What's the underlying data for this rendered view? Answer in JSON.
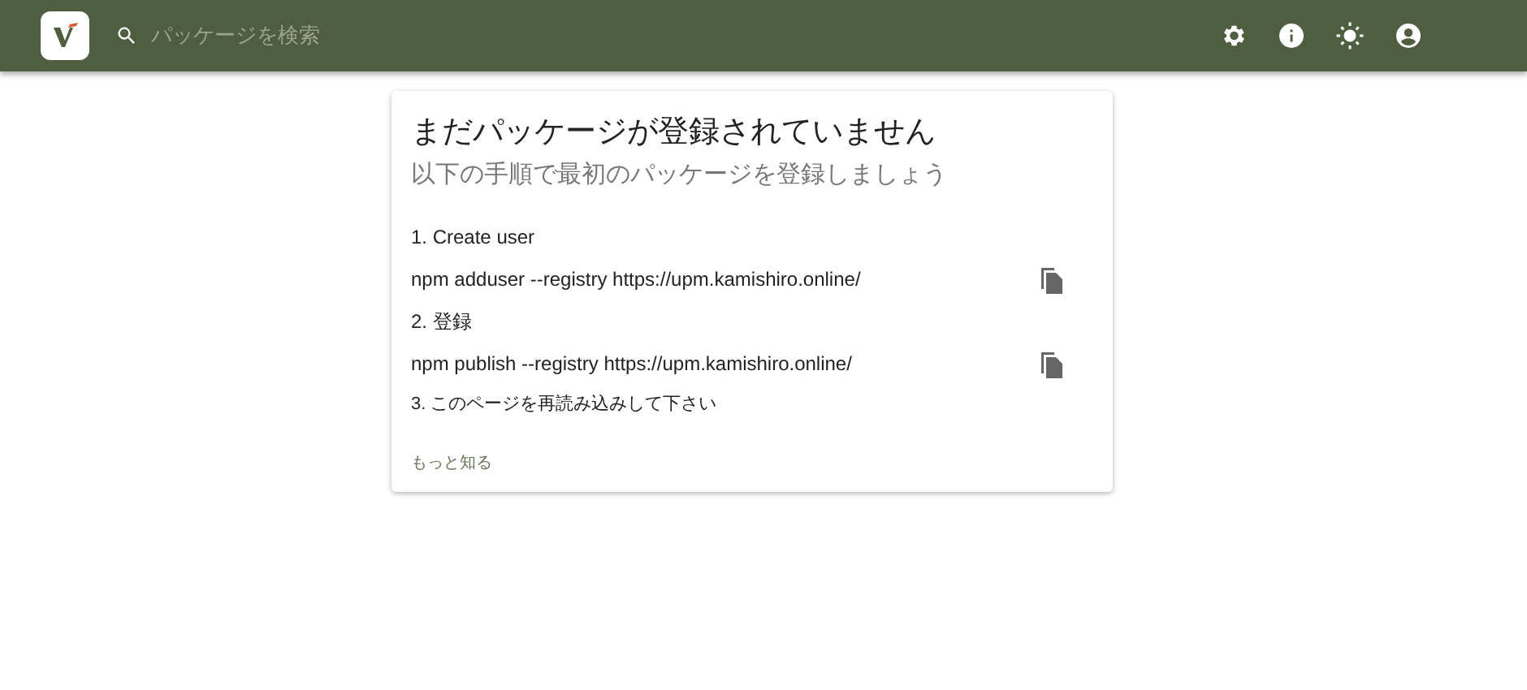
{
  "header": {
    "search": {
      "placeholder": "パッケージを検索"
    },
    "actions": [
      {
        "kind": "settings"
      },
      {
        "kind": "info"
      },
      {
        "kind": "theme"
      },
      {
        "kind": "account"
      }
    ]
  },
  "card": {
    "title": "まだパッケージが登録されていません",
    "subtitle": "以下の手順で最初のパッケージを登録しましょう",
    "steps": [
      {
        "kind": "step",
        "text": "1. Create user"
      },
      {
        "kind": "command",
        "text": "npm adduser --registry https://upm.kamishiro.online/"
      },
      {
        "kind": "step",
        "text": "2. 登録"
      },
      {
        "kind": "command",
        "text": "npm publish --registry https://upm.kamishiro.online/"
      },
      {
        "kind": "note",
        "text": "3. このページを再読み込みして下さい"
      }
    ],
    "link": "もっと知る"
  }
}
